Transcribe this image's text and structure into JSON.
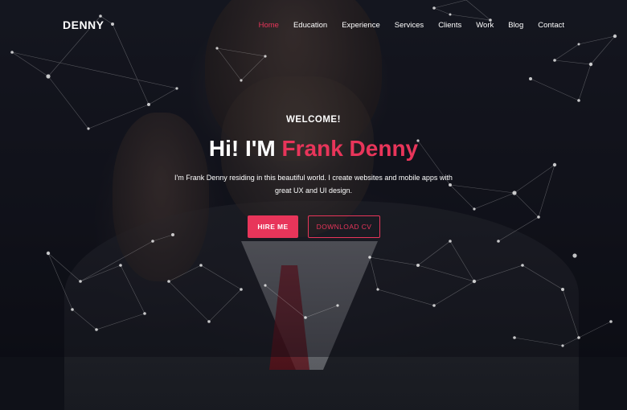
{
  "brand": {
    "logo": "DENNY"
  },
  "nav": {
    "items": [
      {
        "label": "Home",
        "active": true
      },
      {
        "label": "Education",
        "active": false
      },
      {
        "label": "Experience",
        "active": false
      },
      {
        "label": "Services",
        "active": false
      },
      {
        "label": "Clients",
        "active": false
      },
      {
        "label": "Work",
        "active": false
      },
      {
        "label": "Blog",
        "active": false
      },
      {
        "label": "Contact",
        "active": false
      }
    ]
  },
  "hero": {
    "welcome": "WELCOME!",
    "title_prefix": "Hi! I'M ",
    "title_name": "Frank Denny",
    "description": "I'm Frank Denny residing in this beautiful world. I create websites and mobile apps with great UX and UI design.",
    "hire_label": "HIRE ME",
    "cv_label": "DOWNLOAD CV"
  },
  "colors": {
    "accent": "#e8355a",
    "text": "#ffffff",
    "background": "#0f1118"
  }
}
